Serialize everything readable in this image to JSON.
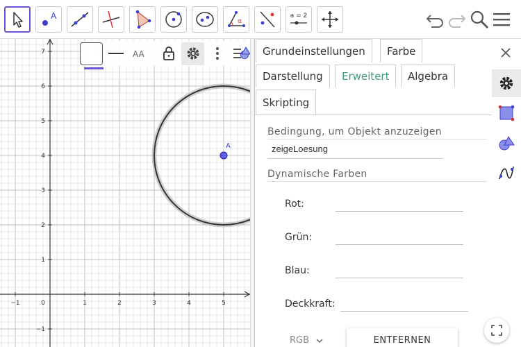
{
  "colors": {
    "accent": "#6557d2",
    "selected_tab": "#3d9a7a",
    "point_fill": "#5a5ee0",
    "circle_stroke": "#333333"
  },
  "toolbar": {
    "tools": [
      {
        "name": "move",
        "icon": "cursor-arrow-icon"
      },
      {
        "name": "point",
        "icon": "point-tool-icon",
        "label": "A"
      },
      {
        "name": "line",
        "icon": "line-tool-icon"
      },
      {
        "name": "perpendicular",
        "icon": "perpendicular-line-icon"
      },
      {
        "name": "polygon",
        "icon": "polygon-tool-icon"
      },
      {
        "name": "circle",
        "icon": "circle-center-point-icon"
      },
      {
        "name": "ellipse",
        "icon": "ellipse-tool-icon"
      },
      {
        "name": "angle",
        "icon": "angle-tool-icon",
        "label": "α"
      },
      {
        "name": "reflect",
        "icon": "reflect-tool-icon"
      },
      {
        "name": "slider",
        "icon": "slider-tool-icon",
        "label": "a = 2"
      },
      {
        "name": "move-view",
        "icon": "move-graphics-view-icon"
      }
    ],
    "header": [
      "undo-icon",
      "redo-icon",
      "search-icon",
      "menu-icon"
    ]
  },
  "style_bar": {
    "icons": [
      "color-swatch-icon",
      "line-style-icon",
      "label-style-icon",
      "lock-icon",
      "gear-icon",
      "more-vert-icon",
      "toggle-style-bar-icon"
    ],
    "label_aa": "AA"
  },
  "graphics": {
    "x_ticks": [
      "−1",
      "0",
      "1",
      "2",
      "3",
      "4",
      "5"
    ],
    "y_ticks": [
      "7",
      "6",
      "5",
      "4",
      "3",
      "2",
      "1",
      "−1"
    ],
    "point_label": "A",
    "point_A": {
      "x": 5,
      "y": 4
    },
    "circle": {
      "center": {
        "x": 5,
        "y": 4
      },
      "radius": 2
    }
  },
  "properties": {
    "tabs_row1": [
      "Grundeinstellungen",
      "Farbe"
    ],
    "tabs_row2": [
      "Darstellung",
      "Erweitert",
      "Algebra"
    ],
    "tabs_row3": [
      "Skripting"
    ],
    "selected_tab": "Erweitert",
    "condition_label": "Bedingung, um Objekt anzuzeigen",
    "condition_value": "zeigeLoesung",
    "dynamic_colors_label": "Dynamische Farben",
    "colors": {
      "red": "Rot:",
      "green": "Grün:",
      "blue": "Blau:",
      "opacity": "Deckkraft:"
    },
    "color_mode": "RGB",
    "remove_button": "ENTFERNEN"
  },
  "rail": [
    "gear-icon",
    "graphics-view-icon",
    "graphics-3d-icon",
    "function-graph-icon"
  ]
}
